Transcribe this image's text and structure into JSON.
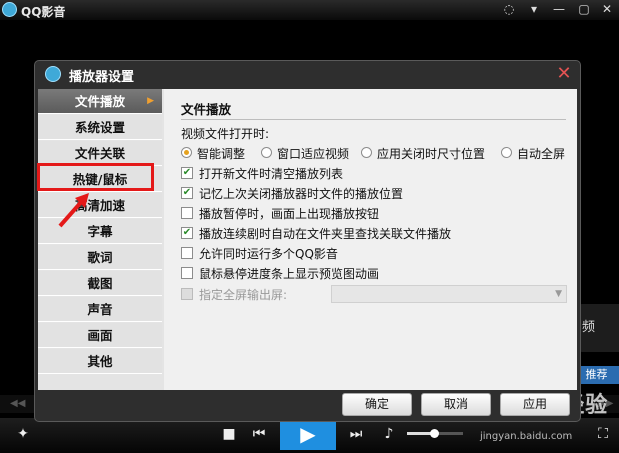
{
  "app": {
    "title": "QQ影音",
    "side_text": "频",
    "recommend_label": "推荐",
    "watermark_logo": "Baidu 经验",
    "watermark_url": "jingyan.baidu.com"
  },
  "controls": {
    "volume_level": 0.45
  },
  "dialog": {
    "title": "播放器设置",
    "nav": [
      {
        "label": "文件播放",
        "active": true
      },
      {
        "label": "系统设置"
      },
      {
        "label": "文件关联"
      },
      {
        "label": "热键/鼠标"
      },
      {
        "label": "高清加速"
      },
      {
        "label": "字幕"
      },
      {
        "label": "歌词"
      },
      {
        "label": "截图"
      },
      {
        "label": "声音"
      },
      {
        "label": "画面"
      },
      {
        "label": "其他"
      }
    ],
    "section_title": "文件播放",
    "open_label": "视频文件打开时:",
    "radios": [
      {
        "label": "智能调整",
        "selected": true
      },
      {
        "label": "窗口适应视频",
        "selected": false
      },
      {
        "label": "应用关闭时尺寸位置",
        "selected": false
      },
      {
        "label": "自动全屏",
        "selected": false
      }
    ],
    "checkboxes": [
      {
        "label": "打开新文件时清空播放列表",
        "checked": true
      },
      {
        "label": "记忆上次关闭播放器时文件的播放位置",
        "checked": true
      },
      {
        "label": "播放暂停时，画面上出现播放按钮",
        "checked": false
      },
      {
        "label": "播放连续剧时自动在文件夹里查找关联文件播放",
        "checked": true
      },
      {
        "label": "允许同时运行多个QQ影音",
        "checked": false
      },
      {
        "label": "鼠标悬停进度条上显示预览图动画",
        "checked": false
      },
      {
        "label": "指定全屏输出屏:",
        "checked": false,
        "disabled": true
      }
    ],
    "buttons": {
      "ok": "确定",
      "cancel": "取消",
      "apply": "应用"
    }
  }
}
